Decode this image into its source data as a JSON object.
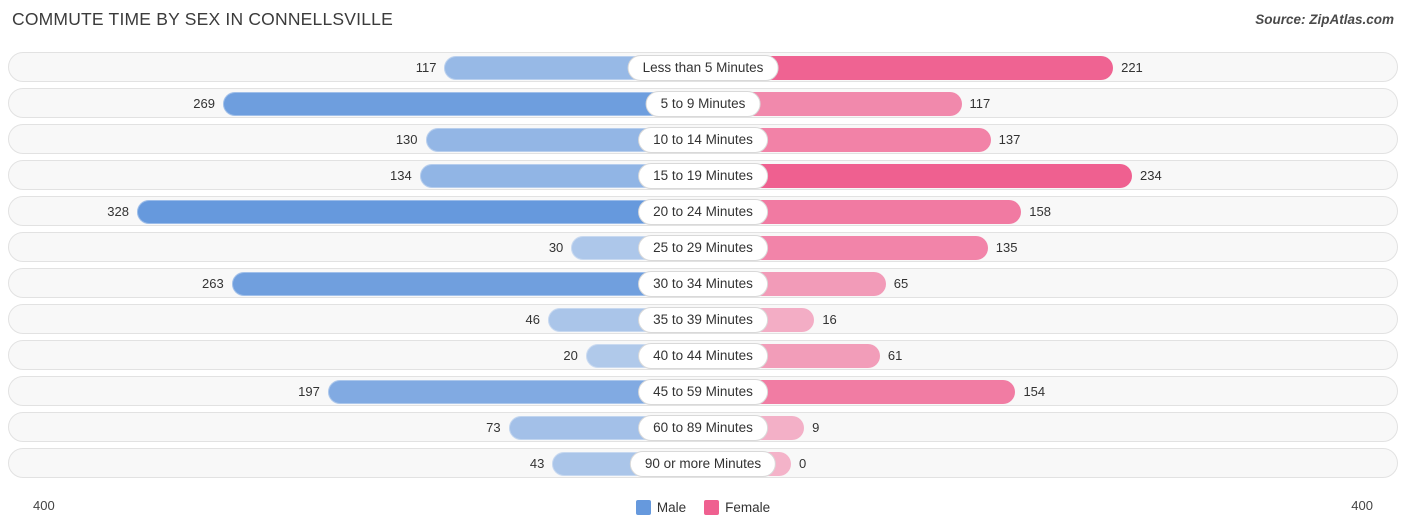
{
  "title": "COMMUTE TIME BY SEX IN CONNELLSVILLE",
  "source": "Source: ZipAtlas.com",
  "axis": {
    "left_label": "400",
    "right_label": "400"
  },
  "legend": {
    "items": [
      {
        "label": "Male",
        "color": "#6699dd"
      },
      {
        "label": "Female",
        "color": "#ef6090"
      }
    ]
  },
  "colors": {
    "male": "#6699dd",
    "female": "#ef6090",
    "row_background": "#f8f8f8",
    "row_border": "#e2e2e2",
    "label_background": "#ffffff"
  },
  "chart_data": {
    "type": "bar",
    "orientation": "horizontal-diverging",
    "title": "COMMUTE TIME BY SEX IN CONNELLSVILLE",
    "xlabel": "",
    "ylabel": "",
    "xlim": [
      400,
      400
    ],
    "grid": false,
    "legend_position": "bottom-center",
    "categories": [
      "Less than 5 Minutes",
      "5 to 9 Minutes",
      "10 to 14 Minutes",
      "15 to 19 Minutes",
      "20 to 24 Minutes",
      "25 to 29 Minutes",
      "30 to 34 Minutes",
      "35 to 39 Minutes",
      "40 to 44 Minutes",
      "45 to 59 Minutes",
      "60 to 89 Minutes",
      "90 or more Minutes"
    ],
    "series": [
      {
        "name": "Male",
        "values": [
          117,
          269,
          130,
          134,
          328,
          30,
          263,
          46,
          20,
          197,
          73,
          43
        ]
      },
      {
        "name": "Female",
        "values": [
          221,
          117,
          137,
          234,
          158,
          135,
          65,
          16,
          61,
          154,
          9,
          0
        ]
      }
    ]
  }
}
